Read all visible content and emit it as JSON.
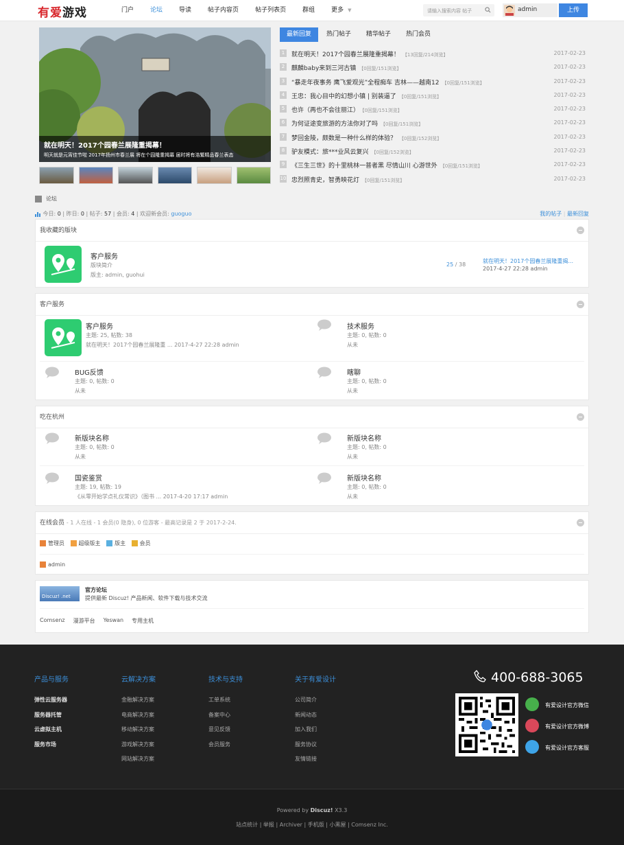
{
  "header": {
    "logo_red": "有爱",
    "logo_dark": "游戏",
    "nav": [
      "门户",
      "论坛",
      "导读",
      "帖子内容页",
      "帖子列表页",
      "群组",
      "更多"
    ],
    "search_placeholder": "请输入搜索内容 帖子",
    "username": "admin",
    "upload": "上传"
  },
  "slider": {
    "caption_title": "就在明天！2017个园春兰展隆重揭幕！",
    "caption_desc": "明天就是元宵佳节啦 2017年扬州市春兰展 将在个园隆重揭幕 届时将有浩繁精品春兰表态"
  },
  "tabs": [
    "最新回复",
    "热门帖子",
    "精华帖子",
    "热门会员"
  ],
  "hot_list": [
    {
      "n": "1",
      "title": "就在明天！2017个园春兰展隆重揭幕！",
      "meta": "【13回复/214浏览】",
      "date": "2017-02-23"
    },
    {
      "n": "2",
      "title": "麒麟baby来到三河古镇",
      "meta": "【0回复/151浏览】",
      "date": "2017-02-23"
    },
    {
      "n": "3",
      "title": "“暴走年夜事务 鹰飞爱观光”全程痴车 吉林——越南12",
      "meta": "【0回复/151浏览】",
      "date": "2017-02-23"
    },
    {
      "n": "4",
      "title": "王忠：我心目中的幻想小镇 | 别装逼了",
      "meta": "【0回复/151浏览】",
      "date": "2017-02-23"
    },
    {
      "n": "5",
      "title": "也许（再也不会往丽江）",
      "meta": "【0回复/151浏览】",
      "date": "2017-02-23"
    },
    {
      "n": "6",
      "title": "为何证途变旅游的方法你对了吗",
      "meta": "【0回复/151浏览】",
      "date": "2017-02-23"
    },
    {
      "n": "7",
      "title": "梦回金陵，颇数是一种什么样的体验？",
      "meta": "【0回复/152浏览】",
      "date": "2017-02-23"
    },
    {
      "n": "8",
      "title": "驴友模式：旅***业风云复兴",
      "meta": "【0回复/152浏览】",
      "date": "2017-02-23"
    },
    {
      "n": "9",
      "title": "《三生三世》的十里桃林一普者黑 尽情山川 心游世外",
      "meta": "【0回复/151浏览】",
      "date": "2017-02-23"
    },
    {
      "n": "10",
      "title": "忠烈照青史，智勇映花灯",
      "meta": "【0回复/151浏览】",
      "date": "2017-02-23"
    }
  ],
  "breadcrumb": "论坛",
  "stats": {
    "today_l": "今日:",
    "today": "0",
    "yest_l": "昨日:",
    "yest": "0",
    "posts_l": "帖子:",
    "posts": "57",
    "members_l": "会员:",
    "members": "4",
    "welcome": "欢迎新会员:",
    "newuser": "guoguo",
    "my_posts": "我的帖子",
    "latest_reply": "最新回复",
    "sep": "|"
  },
  "fav": {
    "title": "我收藏的版块",
    "forum": "客户服务",
    "desc": "版块简介",
    "mods": "版主: admin, guohui",
    "count_a": "25",
    "count_b": "/ 38",
    "last_title": "就在明天！2017个园春兰展隆重揭...",
    "last_time": "2017-4-27 22:28 admin"
  },
  "cat1": {
    "title": "客户服务",
    "forums": [
      {
        "name": "客户服务",
        "stat": "主题: 25, 帖数: 38",
        "last": "就在明天！2017个园春兰展隆重 ... 2017-4-27 22:28 admin"
      },
      {
        "name": "技术服务",
        "stat": "主题: 0, 帖数: 0",
        "last": "从未"
      },
      {
        "name": "BUG反馈",
        "stat": "主题: 0, 帖数: 0",
        "last": "从未"
      },
      {
        "name": "瞎聊",
        "stat": "主题: 0, 帖数: 0",
        "last": "从未"
      }
    ]
  },
  "cat2": {
    "title": "吃在杭州",
    "forums": [
      {
        "name": "新版块名称",
        "stat": "主题: 0, 帖数: 0",
        "last": "从未"
      },
      {
        "name": "新版块名称",
        "stat": "主题: 0, 帖数: 0",
        "last": "从未"
      },
      {
        "name": "国瓷鉴赏",
        "stat": "主题: 19, 帖数: 19",
        "last": "《从零开始学点礼仪常识》（图书 ... 2017-4-20 17:17 admin"
      },
      {
        "name": "新版块名称",
        "stat": "主题: 0, 帖数: 0",
        "last": "从未"
      }
    ]
  },
  "online": {
    "title": "在线会员",
    "info": "- 1 人在线 - 1 会员(0 隐身), 0 位游客 - 最高记录是 2 于 2017-2-24.",
    "legend": [
      "管理员",
      "超级版主",
      "版主",
      "会员"
    ],
    "user": "admin"
  },
  "links": {
    "logo_text": "Discuz! .net",
    "title": "官方论坛",
    "desc": "提供最新 Discuz! 产品新闻、软件下载与技术交流",
    "items": [
      "Comsenz",
      "漫游平台",
      "Yeswan",
      "专用主机"
    ]
  },
  "footer": {
    "cols": [
      {
        "h": "产品与服务",
        "items": [
          "弹性云服务器",
          "服务器托管",
          "云虚拟主机",
          "服务市场"
        ]
      },
      {
        "h": "云解决方案",
        "items": [
          "金融解决方案",
          "电商解决方案",
          "移动解决方案",
          "游戏解决方案",
          "网站解决方案"
        ]
      },
      {
        "h": "技术与支持",
        "items": [
          "工单系统",
          "备案中心",
          "意见反馈",
          "会员服务"
        ]
      },
      {
        "h": "关于有爱设计",
        "items": [
          "公司简介",
          "新闻动态",
          "加入我们",
          "服务协议",
          "友情链接"
        ]
      }
    ],
    "tel": "400-688-3065",
    "sns": [
      "有爱设计官方微信",
      "有爱设计官方微博",
      "有爱设计官方客服"
    ],
    "powered_a": "Powered by",
    "powered_b": "Discuz!",
    "powered_c": "X3.3",
    "bottom_links": "站点统计 | 举报 | Archiver | 手机版 | 小黑屋 | Comsenz Inc."
  },
  "colors": {
    "accent": "#3e86e1",
    "logo_red": "#d8262b",
    "forum_icon": "#2ecc71",
    "footer_bg": "#222222"
  }
}
